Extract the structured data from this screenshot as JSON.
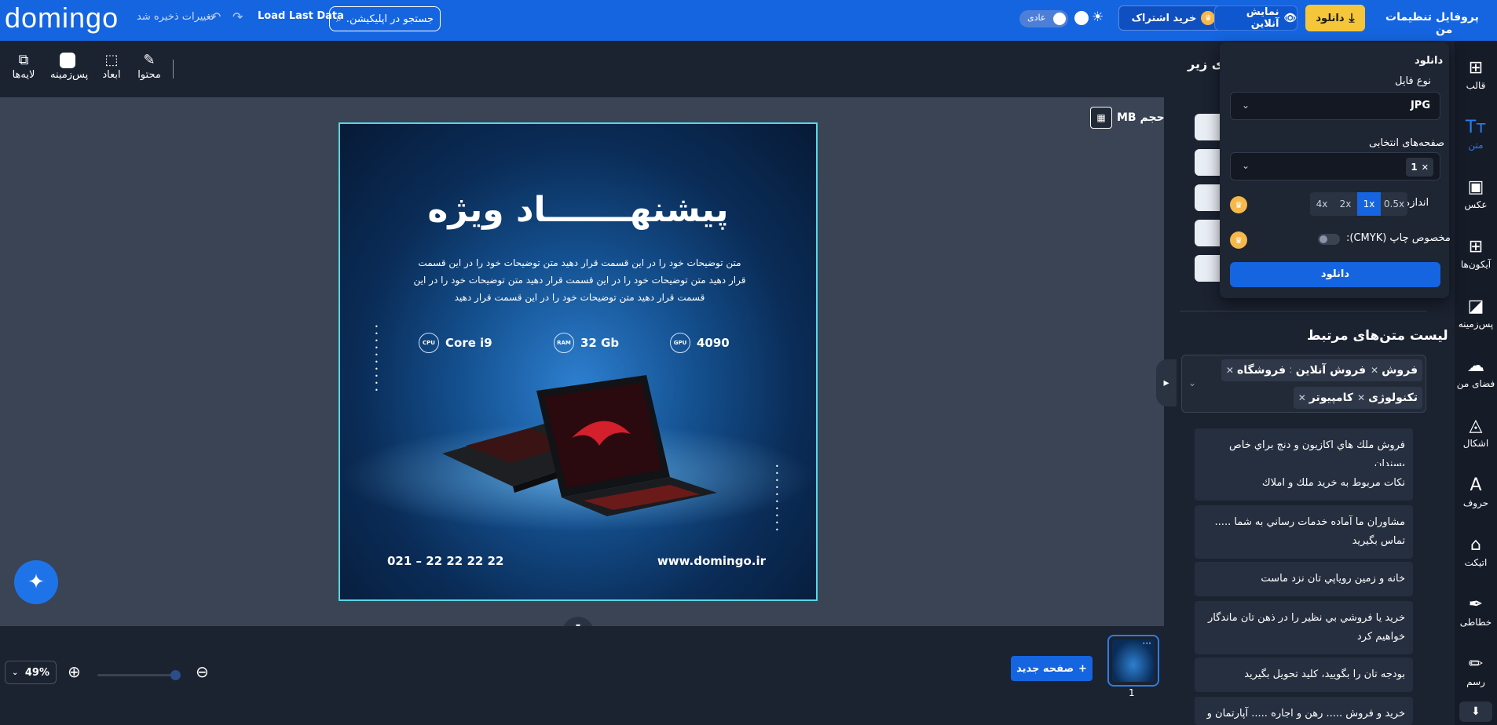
{
  "header": {
    "logo": "domingo",
    "saved_status": "تغییرات ذخیره شد",
    "load_last": "Load Last Data",
    "search_placeholder": "جستجو در اپلیکیشن...",
    "mode_label": "عادی",
    "subscription": "خرید اشتراک",
    "online_view": "نمایش آنلاین",
    "download": "دانلود",
    "settings": "تنظیمات",
    "profile": "پروفایل من"
  },
  "toolbar": {
    "content": "محتوا",
    "dimensions": "ابعاد",
    "background": "پس‌زمینه",
    "layers": "لایه‌ها"
  },
  "canvas": {
    "size_label": "حجم MB",
    "design_title": "پیشنهـــــــاد ویژه",
    "design_desc": "متن توضیحات خود را در این قسمت قرار دهید متن توضیحات خود را در این قسمت قرار دهید متن توضیحات خود را در این قسمت قرار دهید متن توضیحات خود را در این قسمت قرار دهید متن توضیحات خود را در این قسمت قرار دهید",
    "specs": [
      {
        "badge": "CPU",
        "value": "Core i9"
      },
      {
        "badge": "RAM",
        "value": "32 Gb"
      },
      {
        "badge": "GPU",
        "value": "4090"
      }
    ],
    "url": "www.domingo.ir",
    "phone": "021 – 22 22 22 22"
  },
  "bottom": {
    "zoom": "49%",
    "new_page": "صفحه جدید",
    "page_number": "1"
  },
  "panel": {
    "heading_partial": "های زیر",
    "related_title": "لیست متن‌های مرتبط",
    "tags": [
      "فروش",
      "فروش آنلاین",
      "فروشگاه",
      "تکنولوژی",
      "کامپیوتر"
    ],
    "suggestions": [
      "فروش ملك هاي اكازيون و دنج براي خاص پسندان",
      "نكات مربوط به خريد ملك و املاك",
      "مشاوران ما آماده خدمات رساني به شما ..... تماس بگيريد",
      "خانه و زمين روياپي تان نزد ماست",
      "خريد يا فروشي بي نظير را در ذهن تان ماندگار خواهيم كرد",
      "بودجه تان را بگوييد، كليد تحويل بگيريد",
      "خريد و فروش ..... رهن و اجاره ..... آپارتمان و"
    ]
  },
  "sidebar": {
    "items": [
      "قالب",
      "متن",
      "عکس",
      "آیکون‌ها",
      "پس‌زمینه",
      "فضای من",
      "اشکال",
      "حروف",
      "اتیکت",
      "خطاطی",
      "رسم"
    ]
  },
  "download_menu": {
    "title": "دانلود",
    "file_type_label": "نوع فایل",
    "file_type_value": "JPG",
    "pages_label": "صفحه‌های انتخابی",
    "pages_value": "1",
    "size_label": "اندازه:",
    "size_options": [
      "0.5x",
      "1x",
      "2x",
      "4x"
    ],
    "size_selected": "1x",
    "print_label": "مخصوص چاپ (CMYK):",
    "button": "دانلود"
  }
}
